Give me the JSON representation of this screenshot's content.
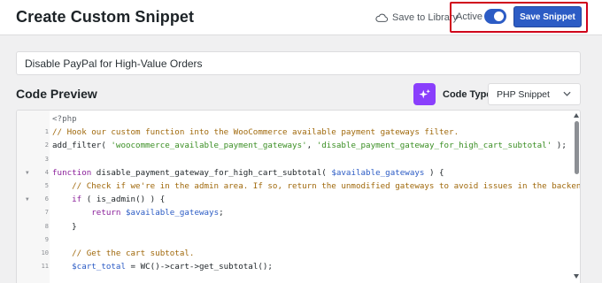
{
  "header": {
    "title": "Create Custom Snippet",
    "save_to_library": "Save to Library",
    "active_label": "Active",
    "active": true,
    "save_button": "Save Snippet",
    "accent_color": "#2c5cc5",
    "highlight_color": "#d0021b"
  },
  "snippet_title": {
    "value": "Disable PayPal for High-Value Orders"
  },
  "code_section": {
    "title": "Code Preview",
    "ai_icon": "sparkle-icon",
    "code_type_label": "Code Type",
    "code_type_value": "PHP Snippet"
  },
  "code_lines": [
    {
      "num": "",
      "text": "<?php"
    },
    {
      "num": "1",
      "text": "// Hook our custom function into the WooCommerce available payment gateways filter."
    },
    {
      "num": "2",
      "text": "add_filter( 'woocommerce_available_payment_gateways', 'disable_payment_gateway_for_high_cart_subtotal' );"
    },
    {
      "num": "3",
      "text": ""
    },
    {
      "num": "4",
      "text": "function disable_payment_gateway_for_high_cart_subtotal( $available_gateways ) {"
    },
    {
      "num": "5",
      "text": "    // Check if we're in the admin area. If so, return the unmodified gateways to avoid issues in the backend."
    },
    {
      "num": "6",
      "text": "    if ( is_admin() ) {"
    },
    {
      "num": "7",
      "text": "        return $available_gateways;"
    },
    {
      "num": "8",
      "text": "    }"
    },
    {
      "num": "9",
      "text": ""
    },
    {
      "num": "10",
      "text": "    // Get the cart subtotal."
    },
    {
      "num": "11",
      "text": "    $cart_total = WC()->cart->get_subtotal();"
    }
  ]
}
